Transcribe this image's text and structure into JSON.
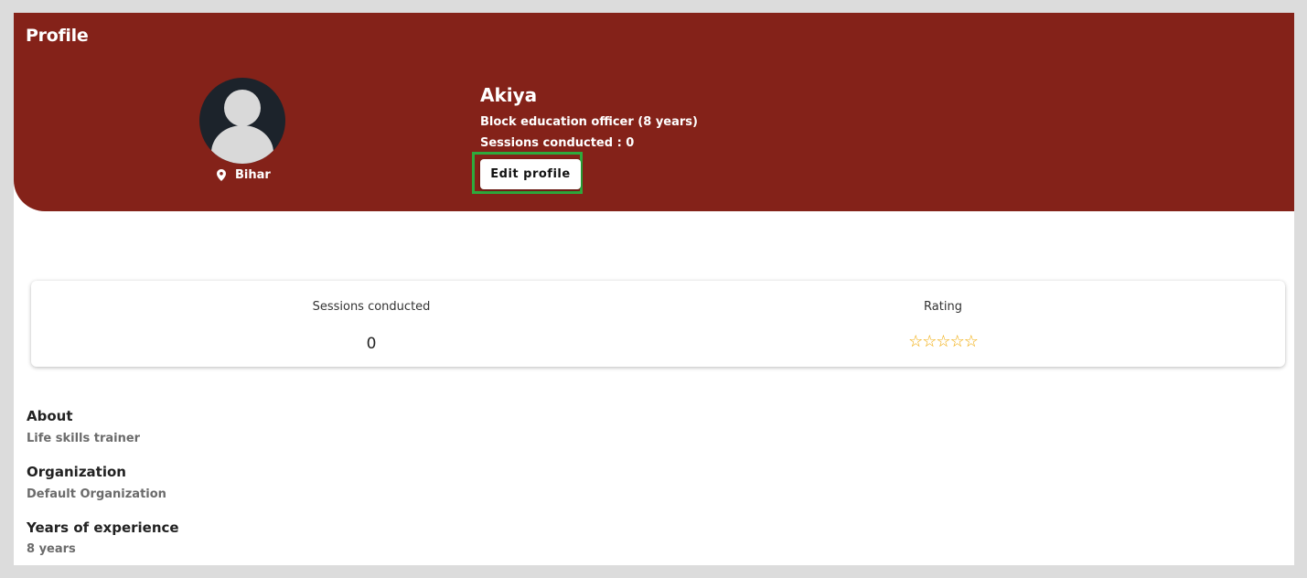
{
  "header": {
    "title": "Profile",
    "background_color": "#842219",
    "location_icon": "map-pin-icon",
    "location": "Bihar",
    "avatar_icon": "user-avatar-placeholder"
  },
  "profile": {
    "name": "Akiya",
    "designation": "Block education officer (8 years)",
    "sessions_conducted_line": "Sessions conducted : 0",
    "edit_button_label": "Edit profile",
    "highlight_color": "#2eaa3c"
  },
  "stats": {
    "sessions_label": "Sessions conducted",
    "sessions_value": "0",
    "rating_label": "Rating",
    "rating_value": 0,
    "rating_max": 5,
    "stars_display": "☆☆☆☆☆",
    "star_color": "#f0a800"
  },
  "details": [
    {
      "title": "About",
      "value": "Life skills trainer"
    },
    {
      "title": "Organization",
      "value": "Default Organization"
    },
    {
      "title": "Years of experience",
      "value": "8 years"
    }
  ]
}
